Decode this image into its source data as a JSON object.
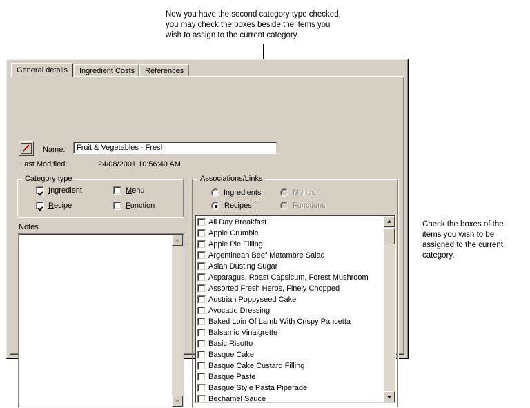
{
  "annotations": {
    "top": "Now you have the second category type checked,\nyou may check the boxes beside the items you\nwish to assign to the current category.",
    "right": "Check the boxes of the\nitems you wish to be\nassigned to the current\ncategory."
  },
  "dialog": {
    "tabs": [
      {
        "label": "General details",
        "active": true
      },
      {
        "label": "Ingredient Costs",
        "active": false
      },
      {
        "label": "References",
        "active": false
      }
    ],
    "edit_icon": "pencil-icon",
    "fields": {
      "name_label": "Name:",
      "name_value": "Fruit & Vegetables - Fresh",
      "name_placeholder": "",
      "last_modified_label": "Last Modified:",
      "last_modified_value": "24/08/2001 10:56:40 AM"
    },
    "category_type": {
      "title": "Category type",
      "options": [
        {
          "label": "Ingredient",
          "accel": "I",
          "checked": true
        },
        {
          "label": "Menu",
          "accel": "M",
          "checked": false
        },
        {
          "label": "Recipe",
          "accel": "R",
          "checked": true
        },
        {
          "label": "Function",
          "accel": "F",
          "checked": false
        }
      ]
    },
    "notes": {
      "label": "Notes",
      "value": ""
    },
    "associations": {
      "title": "Associations/Links",
      "radios": [
        {
          "label": "Ingredients",
          "selected": false,
          "disabled": false
        },
        {
          "label": "Menus",
          "selected": false,
          "disabled": true
        },
        {
          "label": "Recipes",
          "selected": true,
          "disabled": false,
          "focused": true
        },
        {
          "label": "Functions",
          "selected": false,
          "disabled": true
        }
      ],
      "items": [
        {
          "label": "All Day Breakfast",
          "checked": false
        },
        {
          "label": "Apple Crumble",
          "checked": false
        },
        {
          "label": "Apple Pie Filling",
          "checked": false
        },
        {
          "label": "Argentinean Beef Matambre Salad",
          "checked": false
        },
        {
          "label": "Asian Dusting Sugar",
          "checked": false
        },
        {
          "label": "Asparagus, Roast Capsicum, Forest Mushroom",
          "checked": false
        },
        {
          "label": "Assorted Fresh Herbs, Finely Chopped",
          "checked": false
        },
        {
          "label": "Austrian Poppyseed Cake",
          "checked": false
        },
        {
          "label": "Avocado Dressing",
          "checked": false
        },
        {
          "label": "Baked Loin Of Lamb With Crispy Pancetta",
          "checked": false
        },
        {
          "label": "Balsamic Vinaigrette",
          "checked": false
        },
        {
          "label": "Basic Risotto",
          "checked": false
        },
        {
          "label": "Basque Cake",
          "checked": false
        },
        {
          "label": "Basque Cake Custard Filling",
          "checked": false
        },
        {
          "label": "Basque Paste",
          "checked": false
        },
        {
          "label": "Basque Style Pasta Piperade",
          "checked": false
        },
        {
          "label": "Bechamel Sauce",
          "checked": false
        }
      ]
    }
  },
  "colors": {
    "face": "#d6d0c4",
    "window": "#ffffff",
    "shadow": "#85817a",
    "dark_shadow": "#404040",
    "highlight": "#ffffff",
    "disabled_text": "#85817a",
    "accent_red": "#cc0000"
  }
}
